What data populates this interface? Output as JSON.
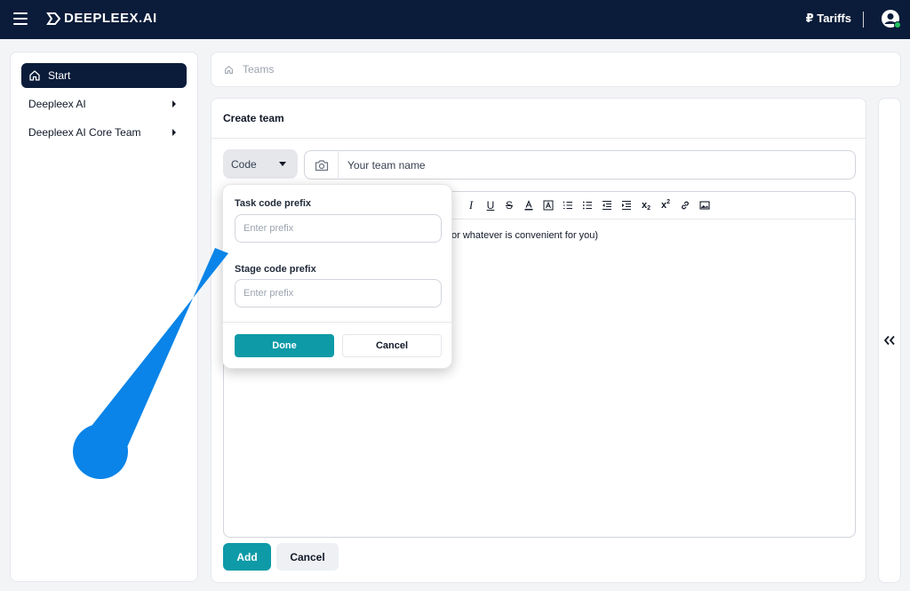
{
  "topbar": {
    "brand": "DEEPLEEX.AI",
    "tariffs_label": "₽ Tariffs"
  },
  "sidebar": {
    "items": [
      {
        "label": "Start",
        "icon": "home-icon",
        "active": true
      },
      {
        "label": "Deepleex AI",
        "icon": "chevron-right-icon"
      },
      {
        "label": "Deepleex AI Core Team",
        "icon": "chevron-right-icon"
      }
    ]
  },
  "breadcrumb": {
    "label": "Teams",
    "icon": "home-icon"
  },
  "create_team": {
    "title": "Create team",
    "code_button": "Code",
    "team_name_placeholder": "Your team name",
    "editor_text": "or whatever is convenient for you)",
    "add_label": "Add",
    "cancel_label": "Cancel"
  },
  "code_popover": {
    "task_prefix_label": "Task code prefix",
    "task_prefix_placeholder": "Enter prefix",
    "stage_prefix_label": "Stage code prefix",
    "stage_prefix_placeholder": "Enter prefix",
    "done_label": "Done",
    "cancel_label": "Cancel"
  },
  "toolbar": {
    "tools": [
      "italic",
      "underline",
      "strikethrough",
      "text-color",
      "highlight",
      "ordered-list",
      "bullet-list",
      "outdent",
      "indent",
      "subscript",
      "superscript",
      "link",
      "image"
    ]
  },
  "colors": {
    "topbar": "#0b1c3a",
    "accent": "#0e9aa7",
    "pointer": "#0a84e8",
    "status_online": "#22c55e"
  }
}
